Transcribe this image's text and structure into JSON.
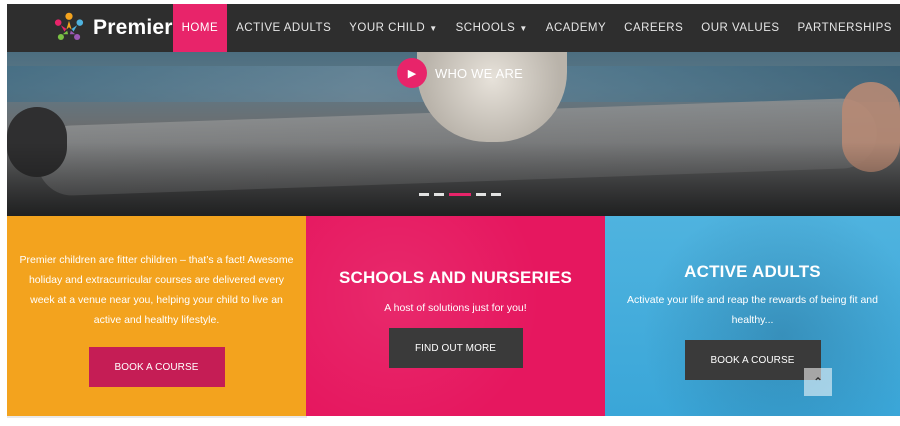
{
  "brand": {
    "name": "Premier",
    "logo_icon": "people-star-logo-icon"
  },
  "nav": {
    "items": [
      {
        "label": "HOME",
        "active": true,
        "dropdown": false
      },
      {
        "label": "ACTIVE ADULTS",
        "active": false,
        "dropdown": false
      },
      {
        "label": "YOUR CHILD",
        "active": false,
        "dropdown": true
      },
      {
        "label": "SCHOOLS",
        "active": false,
        "dropdown": true
      },
      {
        "label": "ACADEMY",
        "active": false,
        "dropdown": false
      },
      {
        "label": "CAREERS",
        "active": false,
        "dropdown": false
      },
      {
        "label": "OUR VALUES",
        "active": false,
        "dropdown": false
      },
      {
        "label": "PARTNERSHIPS",
        "active": false,
        "dropdown": false
      }
    ],
    "dropdown_icon": "chevron-down-icon"
  },
  "hero": {
    "video_link": "WHO WE ARE",
    "play_icon": "play-icon",
    "slides_count": 5,
    "active_slide": 3
  },
  "panels": {
    "children": {
      "text": "Premier children are fitter children – that’s a fact! Awesome holiday and extracurricular courses are delivered every week at a venue near you, helping your child to live an active and healthy lifestyle.",
      "button": "BOOK A COURSE"
    },
    "schools": {
      "heading": "SCHOOLS AND NURSERIES",
      "sub": "A host of solutions just for you!",
      "button": "FIND OUT MORE"
    },
    "adults": {
      "heading": "ACTIVE ADULTS",
      "sub": "Activate your life and reap the rewards of being fit and healthy...",
      "button": "BOOK A COURSE"
    }
  },
  "back_to_top_icon": "chevron-up-icon",
  "colors": {
    "nav_bg": "#2e2e2e",
    "accent_pink": "#e8246a",
    "orange": "#f3a31e",
    "magenta": "#e6175f",
    "blue": "#4fb3df",
    "dark_button": "#3a3a3a"
  }
}
